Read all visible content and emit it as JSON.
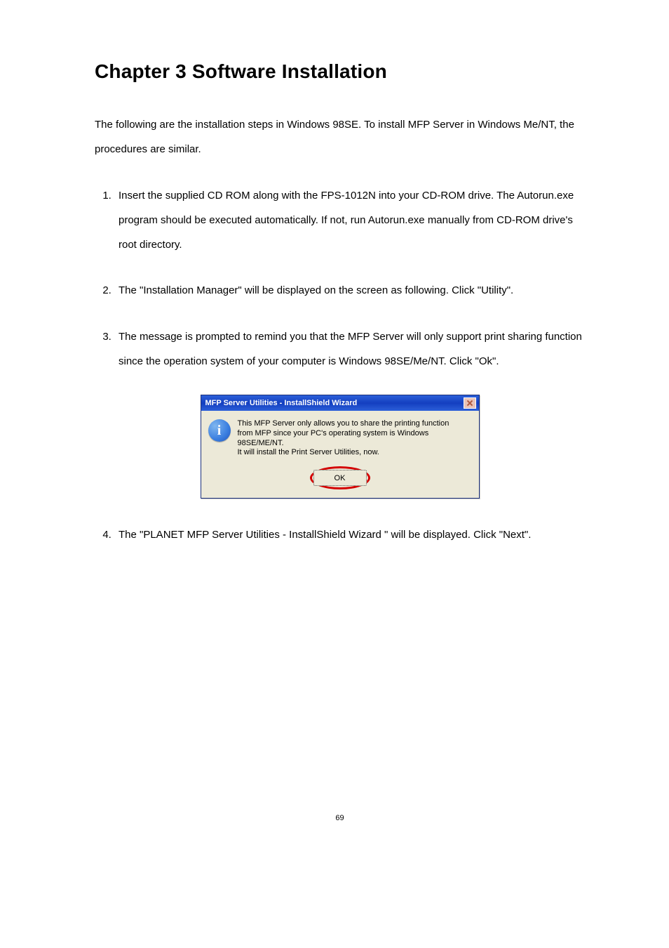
{
  "chapter": {
    "title": "Chapter 3 Software Installation"
  },
  "intro": "The following are the installation steps in Windows 98SE. To install MFP Server in Windows Me/NT, the procedures are similar.",
  "steps": [
    "Insert the supplied CD ROM along with the FPS-1012N into your CD-ROM drive. The Autorun.exe program should be executed automatically. If not, run Autorun.exe manually from CD-ROM drive's root directory.",
    "The \"Installation Manager\" will be displayed on the screen as following. Click \"Utility\".",
    "The message is prompted to remind you that the MFP Server will only support print sharing function since the operation system of your computer is Windows 98SE/Me/NT. Click \"Ok\".",
    "The \"PLANET MFP Server Utilities - InstallShield Wizard \" will be displayed. Click \"Next\"."
  ],
  "dialog": {
    "title": "MFP Server Utilities - InstallShield Wizard",
    "icon_label": "i",
    "message_line1": "This MFP Server only allows you to share the printing function",
    "message_line2": "from MFP since your PC's operating system is Windows 98SE/ME/NT.",
    "message_line3": "It will install the Print Server Utilities, now.",
    "ok_label": "OK"
  },
  "page_number": "69"
}
